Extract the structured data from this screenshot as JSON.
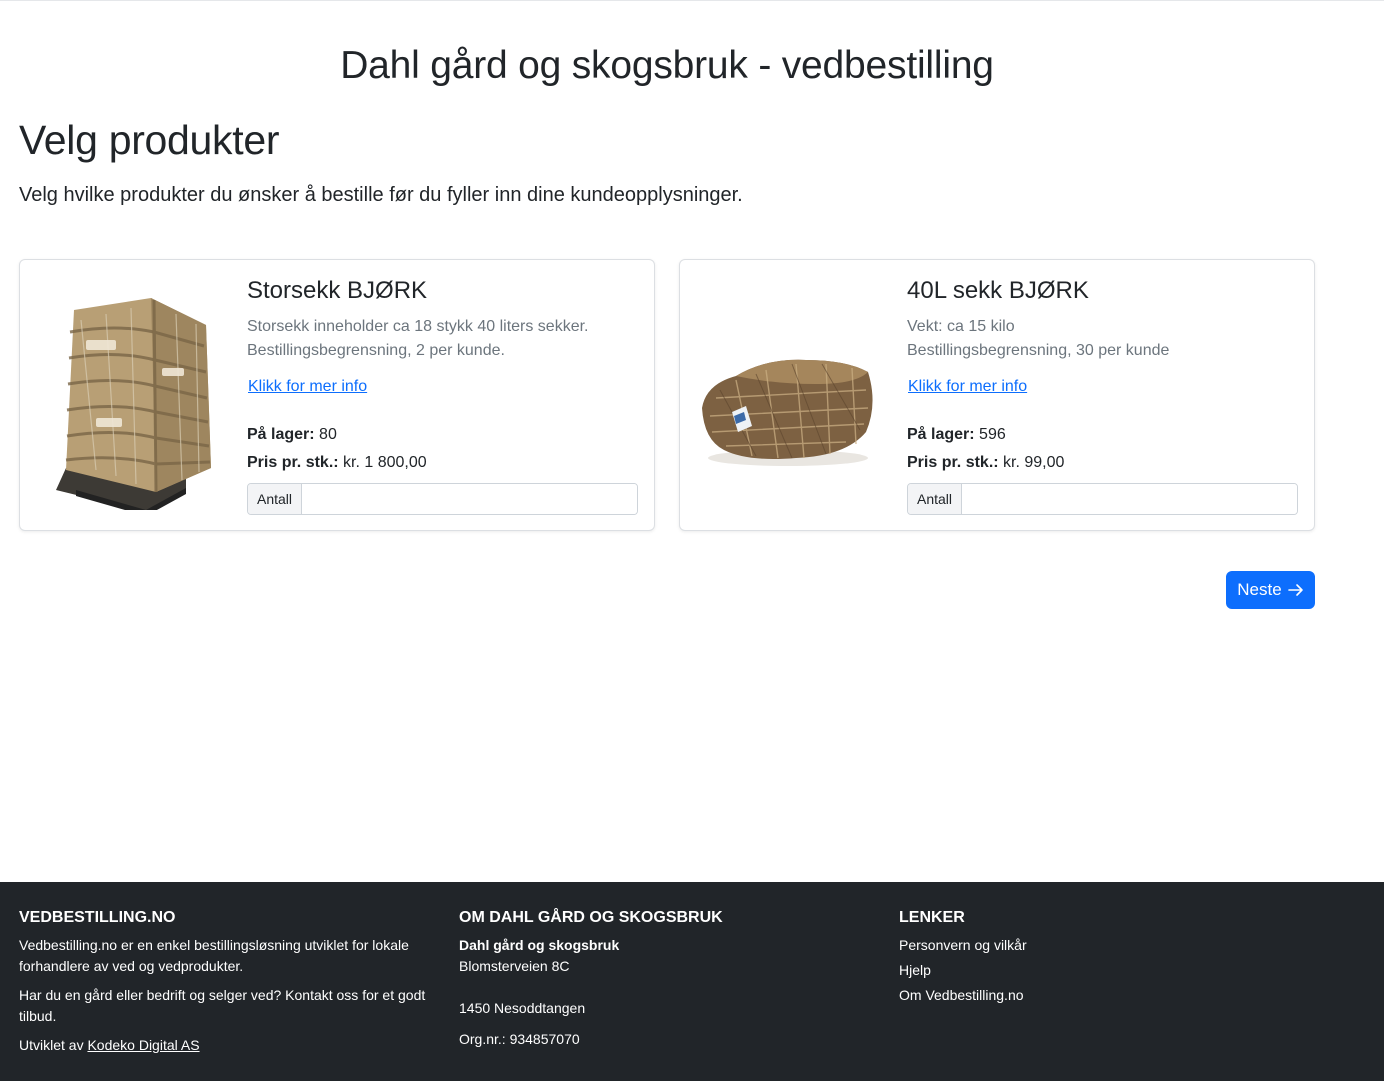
{
  "site": {
    "title": "Dahl gård og skogsbruk - vedbestilling"
  },
  "page": {
    "heading": "Velg produkter",
    "lead": "Velg hvilke produkter du ønsker å bestille før du fyller inn dine kundeopplysninger."
  },
  "products": [
    {
      "name": "Storsekk BJØRK",
      "desc1": "Storsekk inneholder ca 18 stykk 40 liters sekker.",
      "desc2": "Bestillingsbegrensning, 2 per kunde.",
      "link": "Klikk for mer info",
      "stock_label": "På lager:",
      "stock": "80",
      "price_label": "Pris pr. stk.:",
      "price": "kr. 1 800,00",
      "qty_label": "Antall",
      "qty_value": ""
    },
    {
      "name": "40L sekk BJØRK",
      "desc1": "Vekt: ca 15 kilo",
      "desc2": "Bestillingsbegrensning, 30 per kunde",
      "link": "Klikk for mer info",
      "stock_label": "På lager:",
      "stock": "596",
      "price_label": "Pris pr. stk.:",
      "price": "kr. 99,00",
      "qty_label": "Antall",
      "qty_value": ""
    }
  ],
  "actions": {
    "next_label": "Neste",
    "next_icon": "arrow-right-icon"
  },
  "footer": {
    "col1": {
      "heading": "VEDBESTILLING.NO",
      "p1": "Vedbestilling.no er en enkel bestillingsløsning utviklet for lokale forhandlere av ved og vedprodukter.",
      "p2": "Har du en gård eller bedrift og selger ved? Kontakt oss for et godt tilbud.",
      "credit_prefix": "Utviklet av",
      "credit_link": "Kodeko Digital AS"
    },
    "col2": {
      "heading": "OM DAHL GÅRD OG SKOGSBRUK",
      "name": "Dahl gård og skogsbruk",
      "street": "Blomsterveien 8C",
      "city": "1450 Nesoddtangen",
      "org": "Org.nr.: 934857070"
    },
    "col3": {
      "heading": "LENKER",
      "links": [
        "Personvern og vilkår",
        "Hjelp",
        "Om Vedbestilling.no"
      ]
    }
  },
  "colors": {
    "accent": "#0d6efd",
    "footer_bg": "#212529",
    "muted": "#6c757d"
  }
}
